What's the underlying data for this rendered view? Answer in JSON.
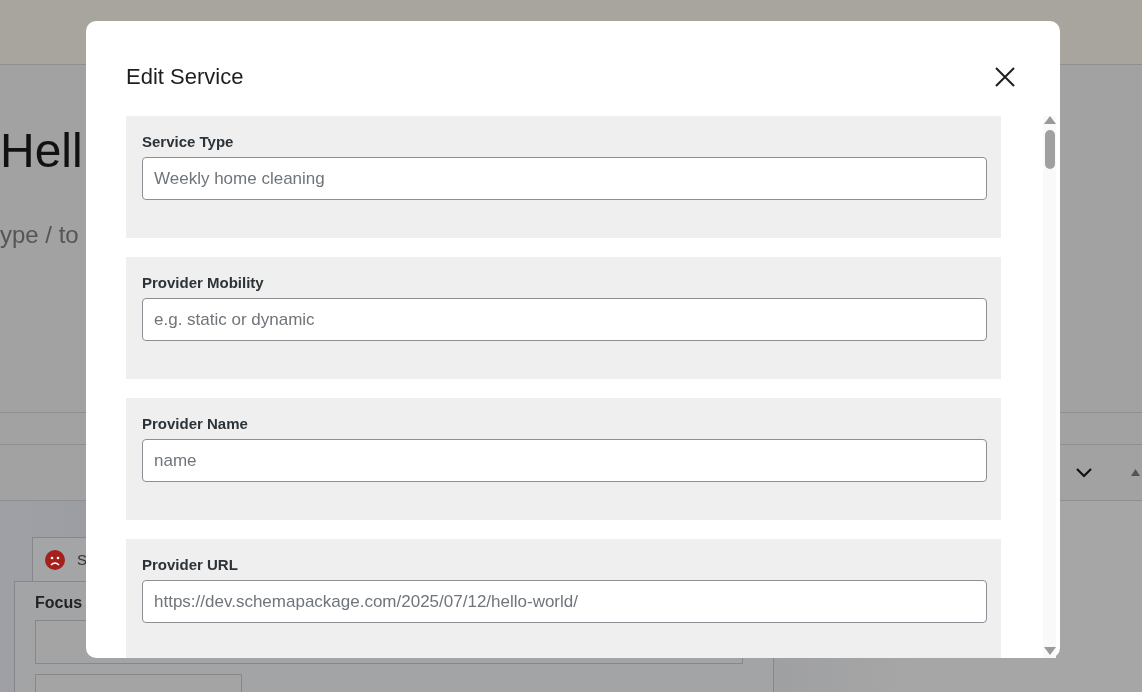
{
  "page": {
    "title": "Hell",
    "subtitle": "ype / to",
    "tab": {
      "label": "S"
    },
    "focus_label": "Focus"
  },
  "dialog": {
    "title": "Edit Service",
    "fields": [
      {
        "label": "Service Type",
        "placeholder": "Weekly home cleaning"
      },
      {
        "label": "Provider Mobility",
        "placeholder": "e.g. static or dynamic"
      },
      {
        "label": "Provider Name",
        "placeholder": "name"
      },
      {
        "label": "Provider URL",
        "placeholder": "https://dev.schemapackage.com/2025/07/12/hello-world/"
      }
    ]
  }
}
